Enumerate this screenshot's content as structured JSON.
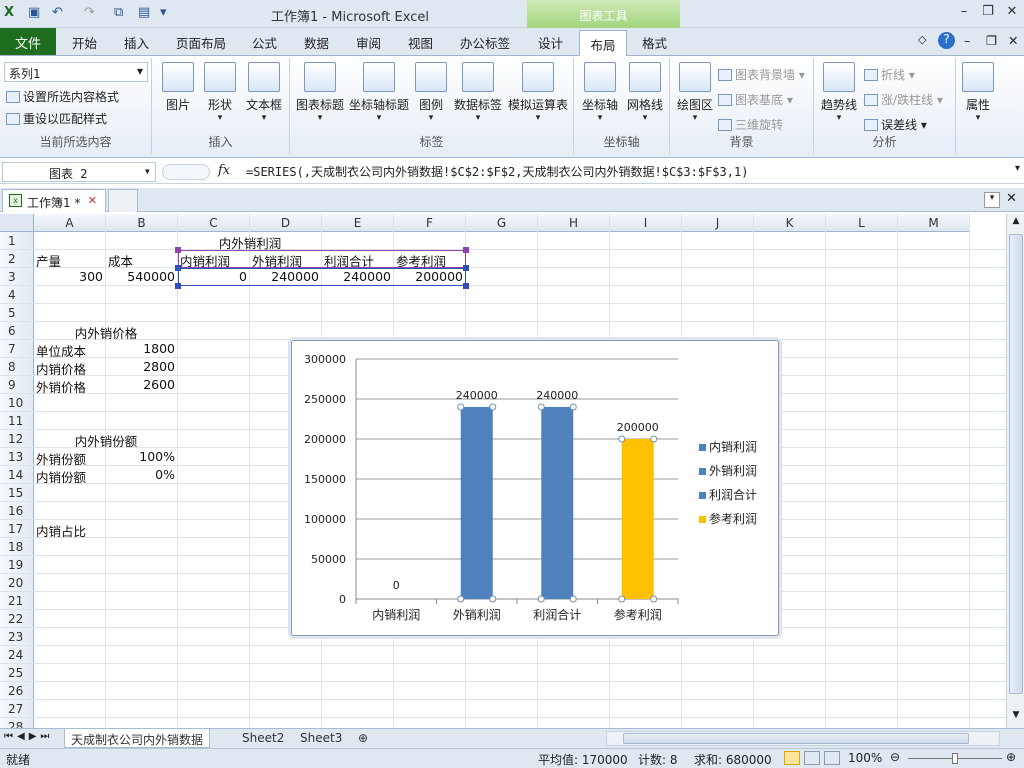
{
  "window": {
    "title": "工作簿1 - Microsoft Excel",
    "contextual_group": "图表工具"
  },
  "tabs": {
    "file": "文件",
    "items": [
      "开始",
      "插入",
      "页面布局",
      "公式",
      "数据",
      "审阅",
      "视图",
      "办公标签",
      "设计",
      "布局",
      "格式"
    ],
    "active": "布局"
  },
  "ribbon": {
    "selection_dropdown": "系列1",
    "format_selection": "设置所选内容格式",
    "reset_style": "重设以匹配样式",
    "group_current": "当前所选内容",
    "insert_buttons": [
      "图片",
      "形状",
      "文本框"
    ],
    "group_insert": "插入",
    "label_buttons": [
      "图表标题",
      "坐标轴标题",
      "图例",
      "数据标签",
      "模拟运算表"
    ],
    "group_labels": "标签",
    "axis_buttons": [
      "坐标轴",
      "网格线"
    ],
    "group_axes": "坐标轴",
    "plot_area": "绘图区",
    "bg_small": [
      "图表背景墙",
      "图表基底",
      "三维旋转"
    ],
    "group_background": "背景",
    "trendline": "趋势线",
    "analysis_small": [
      "折线",
      "涨/跌柱线",
      "误差线"
    ],
    "group_analysis": "分析",
    "properties": "属性"
  },
  "formula_bar": {
    "name_box": "图表 2",
    "fx": "fx",
    "formula": "=SERIES(,天成制衣公司内外销数据!$C$2:$F$2,天成制衣公司内外销数据!$C$3:$F$3,1)"
  },
  "doc_tab": "工作簿1 *",
  "columns": [
    "A",
    "B",
    "C",
    "D",
    "E",
    "F",
    "G",
    "H",
    "I",
    "J",
    "K",
    "L",
    "M"
  ],
  "rows": [
    "1",
    "2",
    "3",
    "4",
    "5",
    "6",
    "7",
    "8",
    "9",
    "10",
    "11",
    "12",
    "13",
    "14",
    "15",
    "16",
    "17",
    "18",
    "19",
    "20",
    "21",
    "22",
    "23",
    "24",
    "25",
    "26",
    "27",
    "28"
  ],
  "cells": {
    "c1": "内外销利润",
    "a2": "产量",
    "b2": "成本",
    "c2": "内销利润",
    "d2": "外销利润",
    "e2": "利润合计",
    "f2": "参考利润",
    "a3": "300",
    "b3": "540000",
    "c3": "0",
    "d3": "240000",
    "e3": "240000",
    "f3": "200000",
    "a6": "内外销价格",
    "a7": "单位成本",
    "b7": "1800",
    "a8": "内销价格",
    "b8": "2800",
    "a9": "外销价格",
    "b9": "2600",
    "a12": "内外销份额",
    "a13": "外销份额",
    "b13": "100%",
    "a14": "内销份额",
    "b14": "0%",
    "a17": "内销占比"
  },
  "chart_data": {
    "type": "bar",
    "categories": [
      "内销利润",
      "外销利润",
      "利润合计",
      "参考利润"
    ],
    "values": [
      0,
      240000,
      240000,
      200000
    ],
    "data_labels": [
      "0",
      "240000",
      "240000",
      "200000"
    ],
    "colors": [
      "#4f81bd",
      "#4f81bd",
      "#4f81bd",
      "#ffc000"
    ],
    "legend": [
      "内销利润",
      "外销利润",
      "利润合计",
      "参考利润"
    ],
    "legend_position": "right",
    "yticks": [
      "0",
      "50000",
      "100000",
      "150000",
      "200000",
      "250000",
      "300000"
    ],
    "ylim": [
      0,
      300000
    ],
    "grid": true
  },
  "sheets": [
    "天成制衣公司内外销数据",
    "Sheet2",
    "Sheet3"
  ],
  "status": {
    "ready": "就绪",
    "average": "平均值: 170000",
    "count": "计数: 8",
    "sum": "求和: 680000",
    "zoom": "100%"
  }
}
